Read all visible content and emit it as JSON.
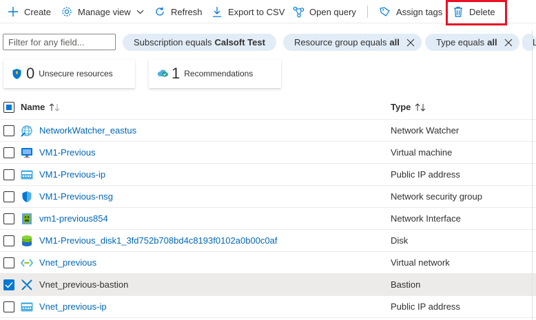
{
  "toolbar": {
    "create": "Create",
    "manage_view": "Manage view",
    "refresh": "Refresh",
    "export_csv": "Export to CSV",
    "open_query": "Open query",
    "assign_tags": "Assign tags",
    "delete": "Delete"
  },
  "filters": {
    "placeholder": "Filter for any field...",
    "subscription_label": "Subscription equals",
    "subscription_value": "Calsoft Test",
    "resource_group_label": "Resource group equals",
    "resource_group_value": "all",
    "type_label": "Type equals",
    "type_value": "all",
    "overflow_pill": "L"
  },
  "cards": {
    "unsecure_count": "0",
    "unsecure_label": "Unsecure resources",
    "recommendations_count": "1",
    "recommendations_label": "Recommendations"
  },
  "columns": {
    "name": "Name",
    "type": "Type"
  },
  "rows": [
    {
      "name": "NetworkWatcher_eastus",
      "type": "Network Watcher",
      "icon": "network-watcher-icon",
      "checked": false
    },
    {
      "name": "VM1-Previous",
      "type": "Virtual machine",
      "icon": "virtual-machine-icon",
      "checked": false
    },
    {
      "name": "VM1-Previous-ip",
      "type": "Public IP address",
      "icon": "public-ip-icon",
      "checked": false
    },
    {
      "name": "VM1-Previous-nsg",
      "type": "Network security group",
      "icon": "nsg-shield-icon",
      "checked": false
    },
    {
      "name": "vm1-previous854",
      "type": "Network Interface",
      "icon": "network-interface-icon",
      "checked": false
    },
    {
      "name": "VM1-Previous_disk1_3fd752b708bd4c8193f0102a0b00c0af",
      "type": "Disk",
      "icon": "disk-icon",
      "checked": false
    },
    {
      "name": "Vnet_previous",
      "type": "Virtual network",
      "icon": "virtual-network-icon",
      "checked": false
    },
    {
      "name": "Vnet_previous-bastion",
      "type": "Bastion",
      "icon": "bastion-icon",
      "checked": true
    },
    {
      "name": "Vnet_previous-ip",
      "type": "Public IP address",
      "icon": "public-ip-icon",
      "checked": false
    }
  ],
  "colors": {
    "accent": "#0078d4",
    "link": "#0067b8",
    "pill_bg": "#e1ecf7",
    "highlight_border": "#e81123",
    "selected_row": "#edebe9"
  }
}
